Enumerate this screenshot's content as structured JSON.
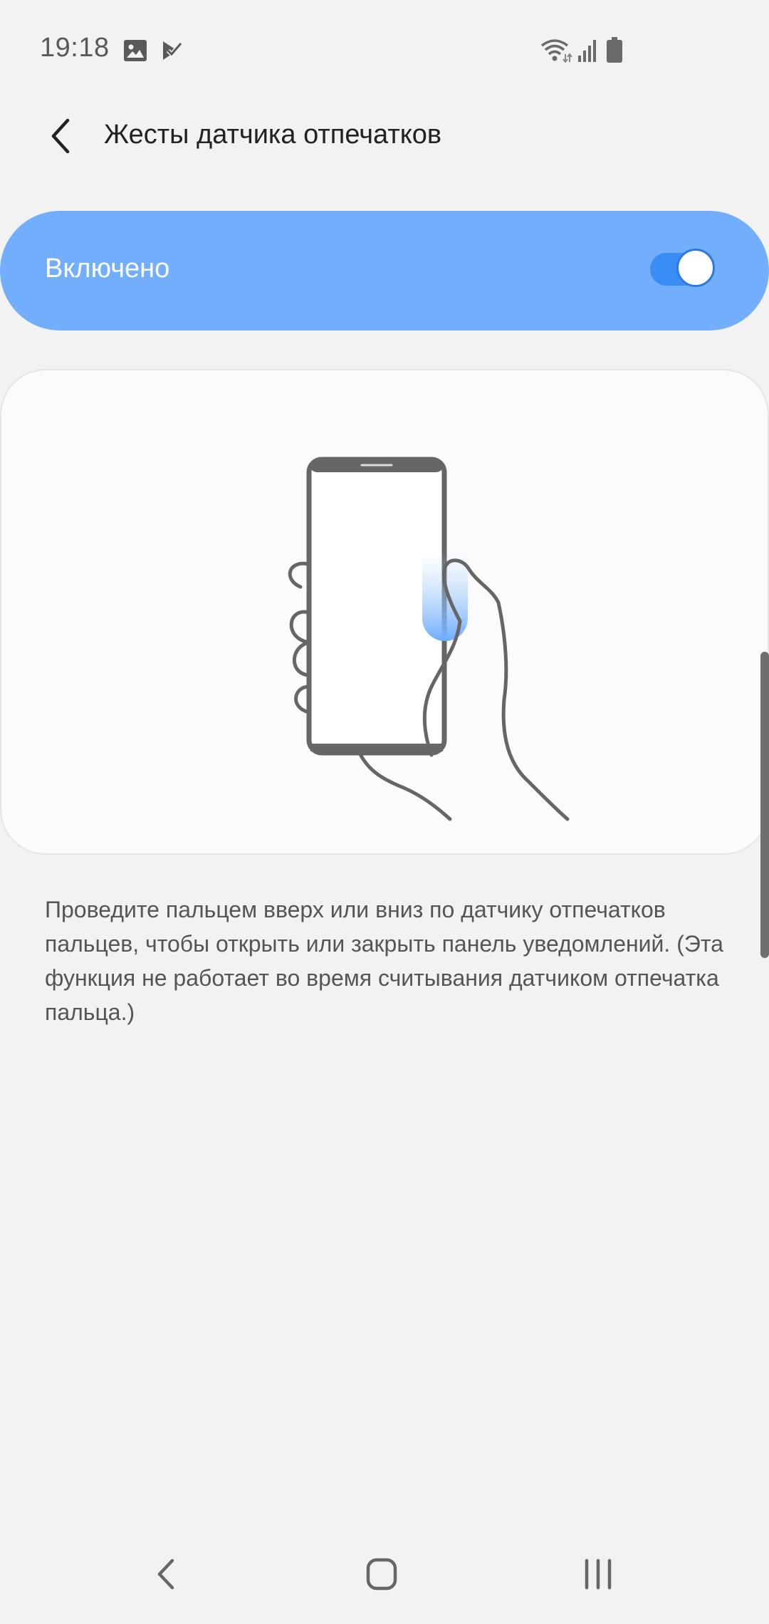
{
  "status_bar": {
    "time": "19:18",
    "left_icons": [
      "gallery-icon",
      "task-check-icon"
    ],
    "right_icons": [
      "wifi-icon",
      "cellular-signal-icon",
      "battery-icon"
    ]
  },
  "app_bar": {
    "back_icon": "chevron-left-icon",
    "title": "Жесты датчика отпечатков"
  },
  "master_switch": {
    "label": "Включено",
    "enabled": true
  },
  "illustration": {
    "subject": "hand-holding-phone-swipe-icon"
  },
  "description": "Проведите пальцем вверх или вниз по датчику отпечатков пальцев, чтобы открыть или закрыть панель уведомлений. (Эта функция не работает во время считывания датчиком отпечатка пальца.)",
  "nav_bar": {
    "back_icon": "nav-back-icon",
    "home_icon": "nav-home-icon",
    "recents_icon": "nav-recents-icon"
  },
  "colors": {
    "background": "#f2f2f2",
    "switch_bar": "#72aefc",
    "toggle_on": "#3a8df5",
    "line_art": "#666666"
  }
}
